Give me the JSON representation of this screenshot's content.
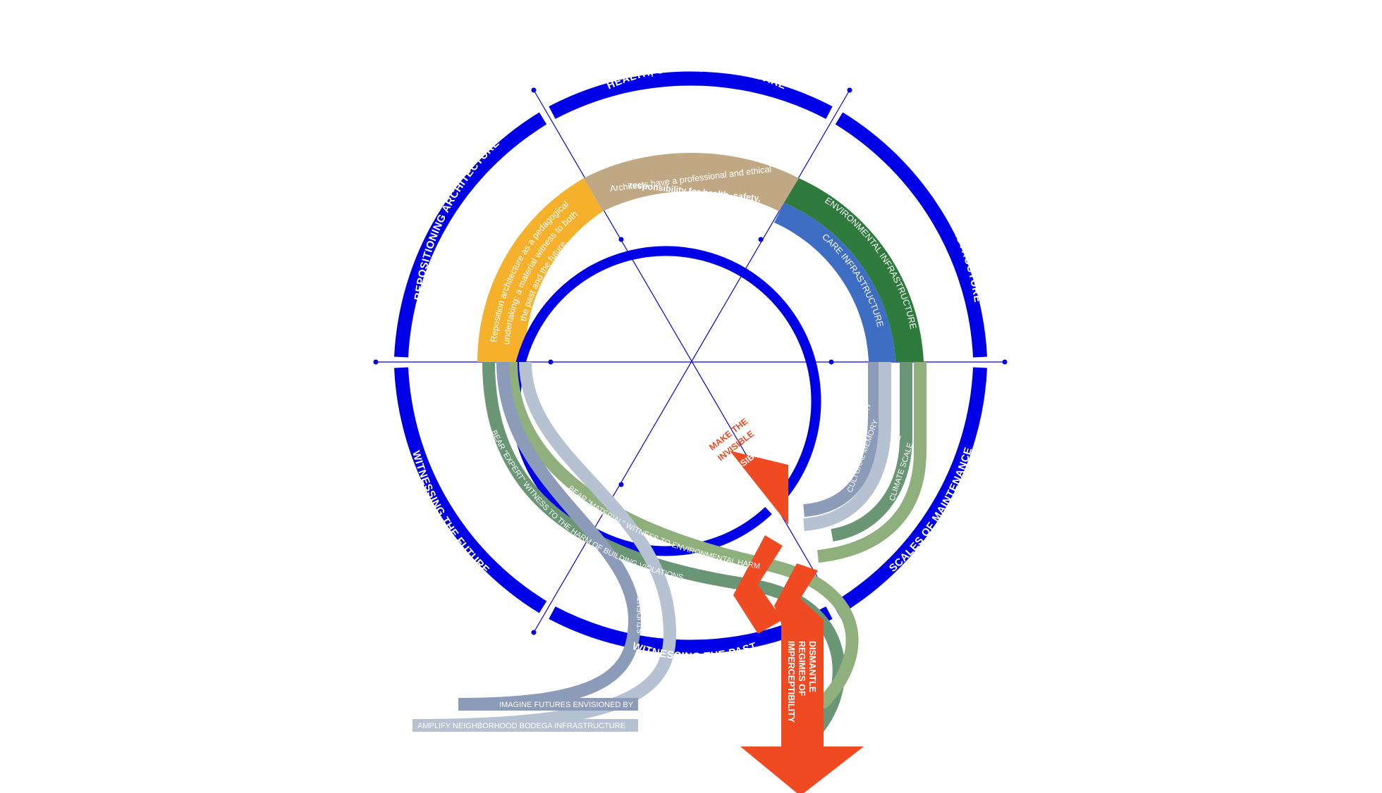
{
  "colors": {
    "ring_blue": "#0000e6",
    "orange": "#f6b12c",
    "tan": "#c0a884",
    "dark_green": "#2f7a3d",
    "mid_blue": "#3e6ec4",
    "slate": "#8b9bb8",
    "light_slate": "#b6c1d2",
    "sage": "#8fb07c",
    "green_gray": "#6a9676",
    "red": "#f04a22"
  },
  "outer_ring": {
    "top": "HEALTH, SAFETY, AND WELFARE",
    "left": "REPOSITIONING ARCHITECTURE",
    "right": "MAINTENANCE INFRASTRUCTURE",
    "bottom_left": "WITNESSING THE FUTURE",
    "bottom_right": "SCALES OF MAINTENANCE",
    "bottom": "WITNESSING THE PAST"
  },
  "bands": {
    "orange_text": [
      "Reposition architecture as a pedagogical",
      "undertaking: a material witness to both",
      "the past and the future."
    ],
    "tan_text": [
      "Architects have a professional and ethical",
      "responsibility for health, safety,",
      "and welfare."
    ],
    "green_label": "ENVIRONMENTAL INFRASTRUCTURE",
    "blue_label": "CARE INFRASTRUCTURE"
  },
  "scales": {
    "institutional": "INSTITUTIONAL MEMORY",
    "cultural": "CULTURAL MEMORY",
    "building": "BUILDING SCALE",
    "climate": "CLIMATE SCALE"
  },
  "witness": {
    "expert": "BEAR “EXPERT” WITNESS TO THE HARM OF BUILDING VIOLATIONS",
    "material": "BEAR “MATERIAL” WITNESS TO ENVIRONMENTAL HARM",
    "students": "STUDENTS",
    "imagine": "IMAGINE FUTURES ENVISIONED BY",
    "amplify": "AMPLIFY NEIGHBORHOOD BODEGA INFRASTRUCTURE"
  },
  "arrows": {
    "make_visible": [
      "MAKE THE",
      "INVISIBLE",
      "VISIBLE"
    ],
    "dismantle": [
      "DISMANTLE",
      "REGIMES OF",
      "IMPERCEPTIBILITY"
    ]
  }
}
